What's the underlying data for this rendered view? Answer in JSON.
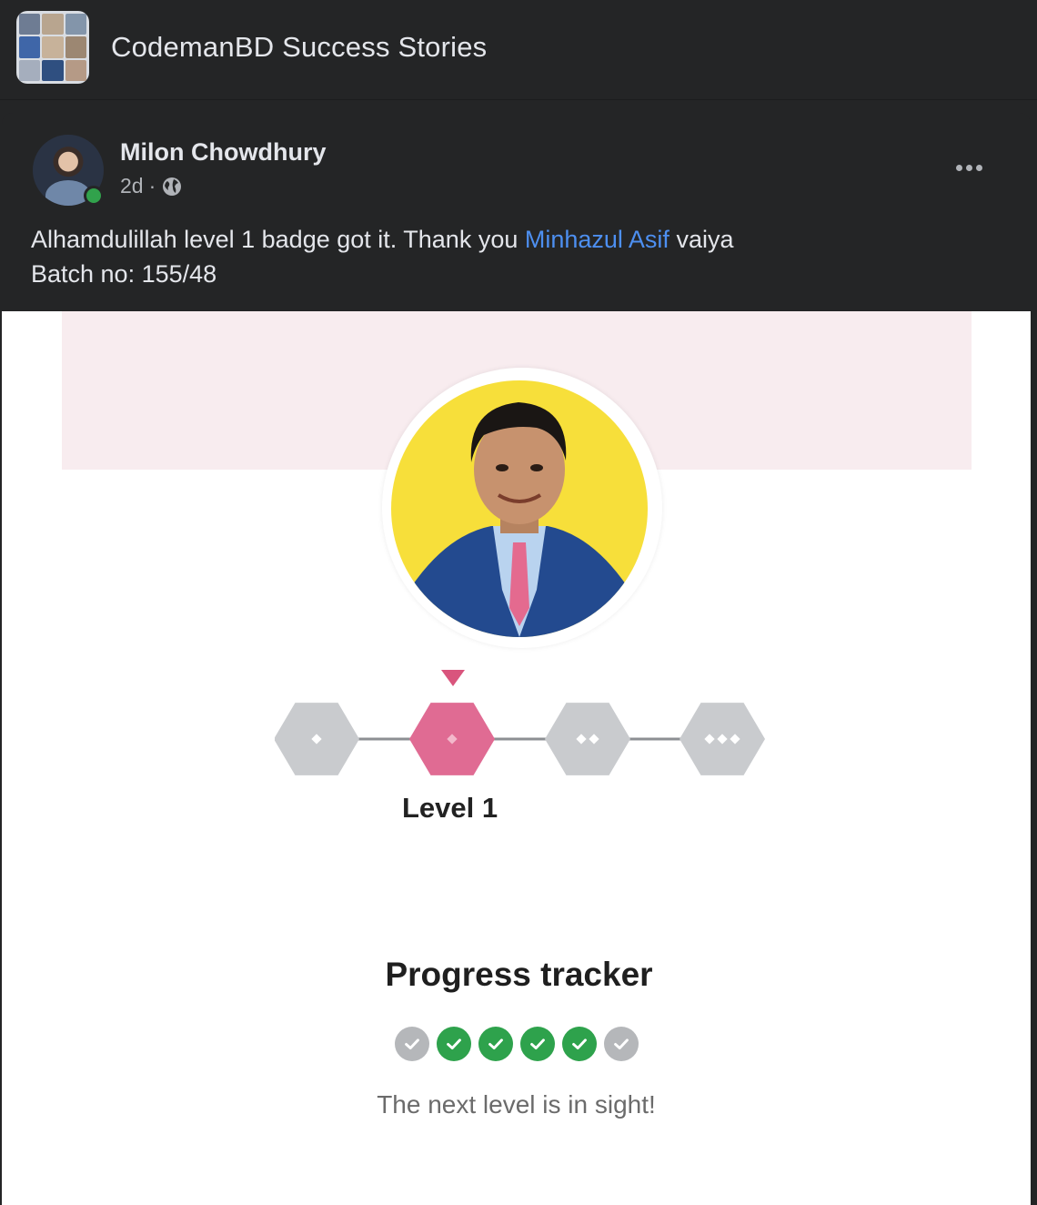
{
  "group": {
    "name": "CodemanBD Success Stories",
    "avatar_icon": "group-collage-icon"
  },
  "post": {
    "author": "Milon Chowdhury",
    "time": "2d",
    "separator": "·",
    "privacy_icon": "globe-icon",
    "online": true,
    "text_before": "Alhamdulillah level 1 badge got it. Thank you ",
    "mention": "Minhazul Asif",
    "text_after": " vaiya",
    "line2": "Batch no: 155/48",
    "more_icon": "more-options-icon"
  },
  "image": {
    "level_label": "Level 1",
    "levels": [
      {
        "dots": 1,
        "active": false
      },
      {
        "dots": 1,
        "active": true
      },
      {
        "dots": 2,
        "active": false
      },
      {
        "dots": 3,
        "active": false
      }
    ],
    "progress_title": "Progress tracker",
    "checks": [
      false,
      true,
      true,
      true,
      true,
      false
    ],
    "caption": "The next level is in sight!"
  },
  "colors": {
    "background": "#242526",
    "text": "#e4e6eb",
    "secondary_text": "#b0b3b8",
    "link": "#4d8ff0",
    "online": "#31a24c",
    "badge_active": "#e06b93",
    "badge_inactive": "#c9cbce",
    "check_done": "#2ea24c",
    "check_todo": "#b5b7ba",
    "photo_background": "#f7df3a"
  }
}
